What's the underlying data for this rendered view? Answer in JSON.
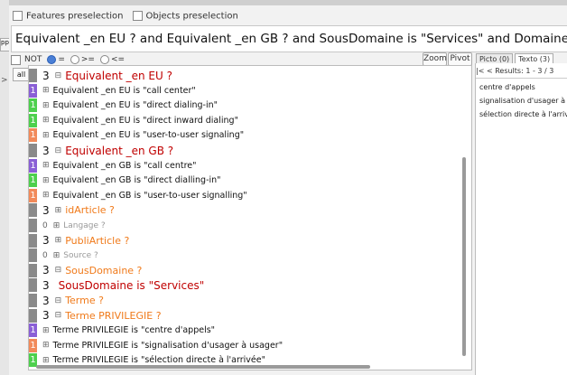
{
  "left_panel": {
    "tab_text": "ppl",
    "arrow": ">"
  },
  "options": {
    "features_label": "Features preselection",
    "objects_label": "Objects preselection"
  },
  "query": "Equivalent _en EU ? and Equivalent _en GB ? and SousDomaine is \"Services\" and Domaine is \"Télécommunications\"",
  "toolbar": {
    "not_label": "NOT",
    "eq_label": "=",
    "ge_label": ">=",
    "le_label": "<=",
    "zoom_label": "Zoom",
    "pivot_label": "Pivot",
    "all_label": "all"
  },
  "tree": [
    {
      "badge": "",
      "count": "3",
      "label": "Equivalent _en EU ?",
      "style": "header-red"
    },
    {
      "badge": "1",
      "color": "purple",
      "label": "Equivalent _en EU is \"call center\""
    },
    {
      "badge": "1",
      "color": "green",
      "label": "Equivalent _en EU is \"direct dialing-in\""
    },
    {
      "badge": "1",
      "color": "green",
      "label": "Equivalent _en EU is \"direct inward dialing\""
    },
    {
      "badge": "1",
      "color": "orange",
      "label": "Equivalent _en EU is \"user-to-user signaling\""
    },
    {
      "badge": "",
      "count": "3",
      "label": "Equivalent _en GB ?",
      "style": "header-red"
    },
    {
      "badge": "1",
      "color": "purple",
      "label": "Equivalent _en GB is \"call centre\""
    },
    {
      "badge": "1",
      "color": "green",
      "label": "Equivalent _en GB is \"direct dialling-in\""
    },
    {
      "badge": "1",
      "color": "orange",
      "label": "Equivalent _en GB is \"user-to-user signalling\""
    },
    {
      "badge": "",
      "count": "3",
      "label": "idArticle ?",
      "style": "header-orange"
    },
    {
      "badge": "",
      "count": "0",
      "label": "Langage ?",
      "style": "muted"
    },
    {
      "badge": "",
      "count": "3",
      "label": "PubliArticle ?",
      "style": "header-orange"
    },
    {
      "badge": "",
      "count": "0",
      "label": "Source ?",
      "style": "muted"
    },
    {
      "badge": "",
      "count": "3",
      "label": "SousDomaine ?",
      "style": "header-orange"
    },
    {
      "badge": "",
      "count": "3",
      "label": "SousDomaine is \"Services\"",
      "style": "value-red"
    },
    {
      "badge": "",
      "count": "3",
      "label": "Terme ?",
      "style": "header-orange"
    },
    {
      "badge": "",
      "count": "3",
      "label": "Terme PRIVILEGIE ?",
      "style": "header-orange-sub"
    },
    {
      "badge": "1",
      "color": "purple",
      "label": "Terme PRIVILEGIE is \"centre d'appels\""
    },
    {
      "badge": "1",
      "color": "orange",
      "label": "Terme PRIVILEGIE is \"signalisation d'usager à usager\""
    },
    {
      "badge": "1",
      "color": "green",
      "label": "Terme PRIVILEGIE is \"sélection directe à l'arrivée\""
    }
  ],
  "right_panel": {
    "tab_picto": "Picto (0)",
    "tab_texto": "Texto (3)",
    "results_prefix": "|<",
    "results_text": "<  Results: 1 - 3 / 3",
    "results": [
      "centre d'appels",
      "signalisation d'usager à usager",
      "sélection directe à l'arrivée"
    ]
  },
  "colors": {
    "purple": "#8a5fd6",
    "green": "#4dd04d",
    "orange": "#f28a5a",
    "grey": "#8a8a8a",
    "red": "#c00000",
    "accent_orange": "#f07a1a"
  },
  "icons": {
    "expand": "plus-box-icon",
    "radio": "radio-icon",
    "checkbox": "checkbox-icon"
  }
}
